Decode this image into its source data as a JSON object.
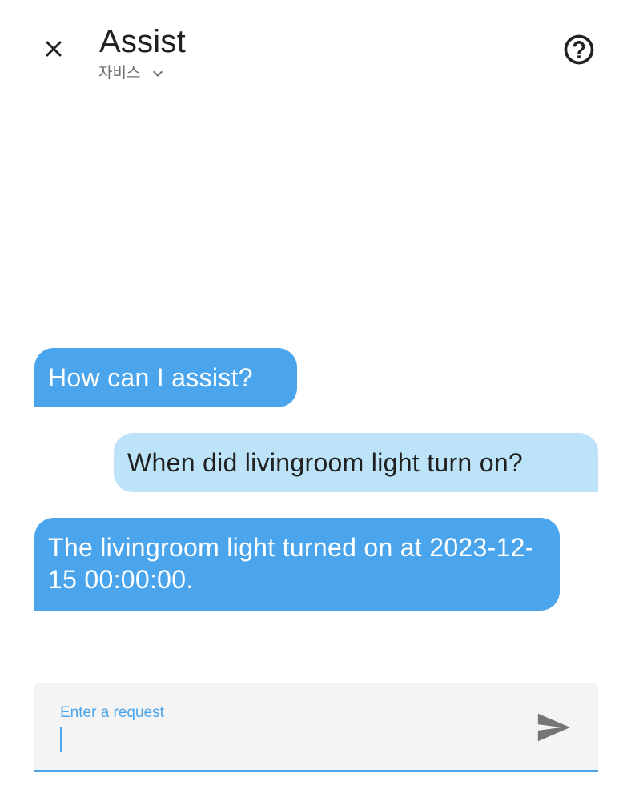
{
  "header": {
    "title": "Assist",
    "pipeline_name": "자비스",
    "close_icon": "close-icon",
    "help_icon": "help-circle-icon",
    "dropdown_icon": "chevron-down-icon"
  },
  "messages": [
    {
      "from": "hass",
      "text": "How can I assist?"
    },
    {
      "from": "user",
      "text": "When did livingroom light turn on?"
    },
    {
      "from": "hass",
      "text": "The livingroom light turned on at 2023-12-15 00:00:00."
    }
  ],
  "input": {
    "label": "Enter a request",
    "value": "",
    "send_icon": "send-icon"
  },
  "colors": {
    "accent": "#4ba5ec",
    "user_bubble": "#bde3f8",
    "input_bg": "#f4f4f4"
  }
}
